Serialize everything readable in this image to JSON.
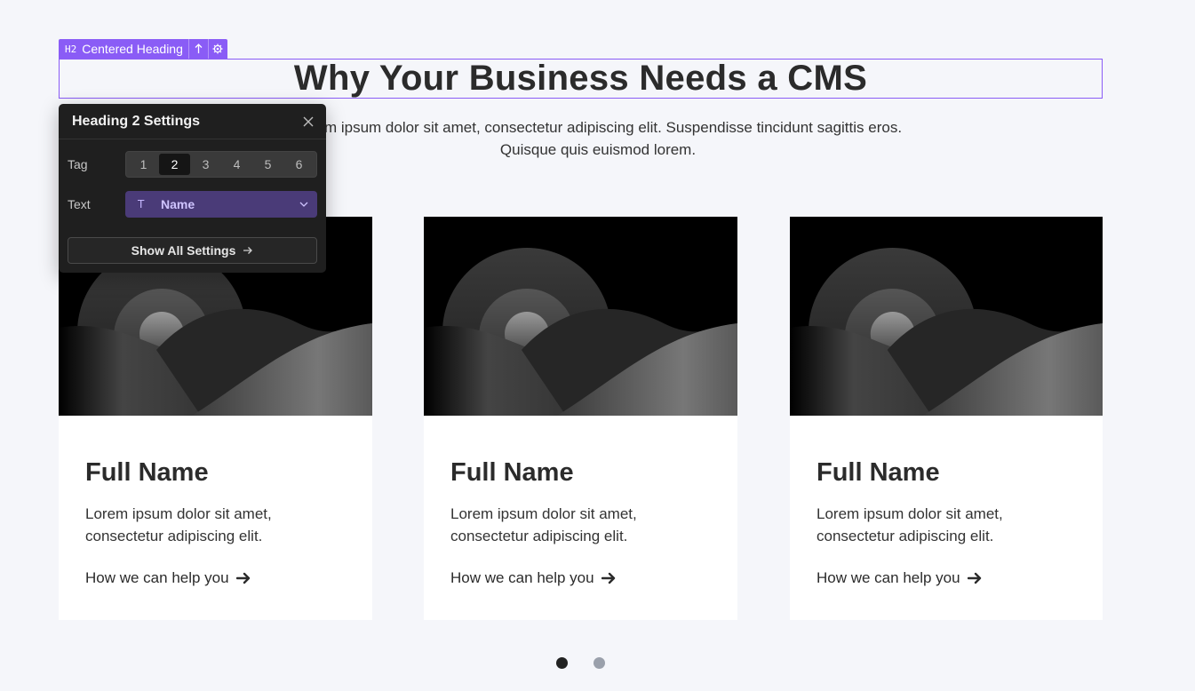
{
  "selection": {
    "tag_badge": "H2",
    "element_name": "Centered Heading",
    "accent_color": "#8a5cf6"
  },
  "heading": {
    "text": "Why Your Business Needs a CMS"
  },
  "subtitle": {
    "text": "Lorem ipsum dolor sit amet, consectetur adipiscing elit. Suspendisse tincidunt sagittis eros. Quisque quis euismod lorem."
  },
  "cards": [
    {
      "title": "Full Name",
      "description": "Lorem ipsum dolor sit amet, consectetur adipiscing elit.",
      "link": "How we can help you"
    },
    {
      "title": "Full Name",
      "description": "Lorem ipsum dolor sit amet, consectetur adipiscing elit.",
      "link": "How we can help you"
    },
    {
      "title": "Full Name",
      "description": "Lorem ipsum dolor sit amet, consectetur adipiscing elit.",
      "link": "How we can help you"
    }
  ],
  "pagination": {
    "active_color": "#222222",
    "inactive_color": "#9aa0ab"
  },
  "settings_panel": {
    "title": "Heading 2 Settings",
    "tag_label": "Tag",
    "tag_options": [
      "1",
      "2",
      "3",
      "4",
      "5",
      "6"
    ],
    "tag_selected": "2",
    "text_label": "Text",
    "text_icon": "T",
    "text_value": "Name",
    "show_all_label": "Show All Settings"
  }
}
